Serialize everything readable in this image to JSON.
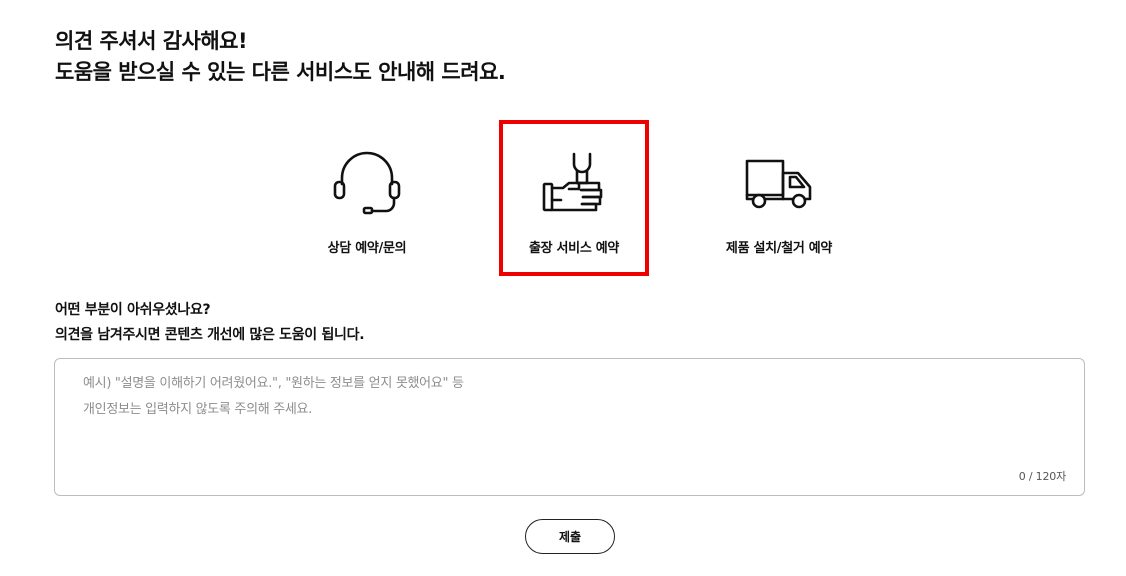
{
  "header": {
    "line1": "의견 주셔서 감사해요!",
    "line2": "도움을 받으실 수 있는 다른 서비스도 안내해 드려요."
  },
  "services": [
    {
      "label": "상담 예약/문의",
      "icon": "headset-icon"
    },
    {
      "label": "출장 서비스 예약",
      "icon": "wrench-hand-icon",
      "highlighted": true
    },
    {
      "label": "제품 설치/철거 예약",
      "icon": "delivery-truck-icon"
    }
  ],
  "colors": {
    "highlight": "#ee0000",
    "text": "#111111",
    "border": "#bdbdbd"
  },
  "feedback": {
    "line1": "어떤 부분이 아쉬우셨나요?",
    "line2": "의견을 남겨주시면 콘텐츠 개선에 많은 도움이 됩니다.",
    "placeholder": "예시) \"설명을 이해하기 어려웠어요.\", \"원하는 정보를 얻지 못했어요\" 등\n개인정보는 입력하지 않도록 주의해 주세요.",
    "value": "",
    "counter": "0 / 120자"
  },
  "submit_label": "제출"
}
